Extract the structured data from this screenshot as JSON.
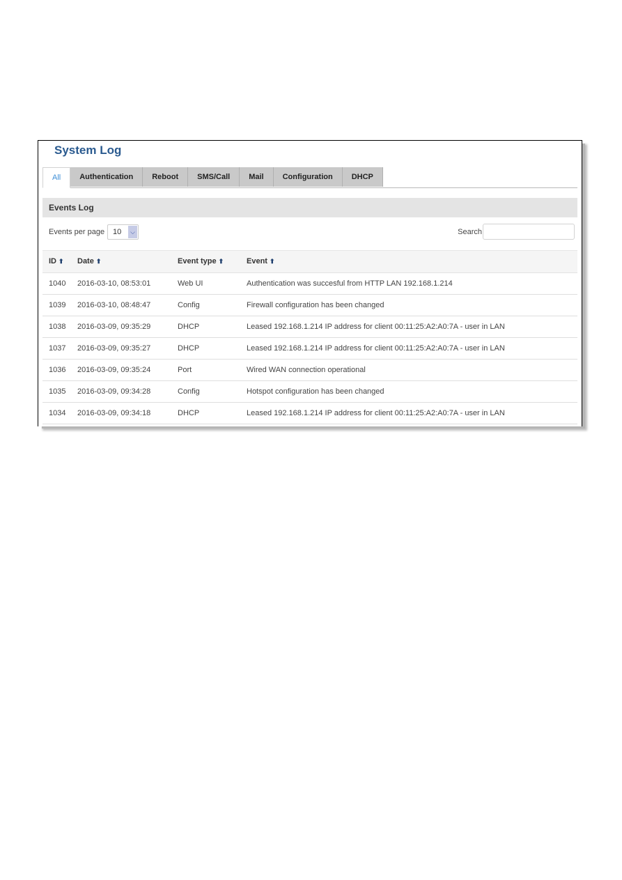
{
  "page": {
    "title": "System Log"
  },
  "tabs": [
    {
      "label": "All",
      "active": true
    },
    {
      "label": "Authentication",
      "active": false
    },
    {
      "label": "Reboot",
      "active": false
    },
    {
      "label": "SMS/Call",
      "active": false
    },
    {
      "label": "Mail",
      "active": false
    },
    {
      "label": "Configuration",
      "active": false
    },
    {
      "label": "DHCP",
      "active": false
    }
  ],
  "events_log": {
    "section_title": "Events Log",
    "per_page_label": "Events per page",
    "per_page_value": "10",
    "per_page_icon": "chevron-down-icon",
    "search_label": "Search",
    "search_value": "",
    "sort_icon": "arrow-up-icon",
    "columns": [
      "ID",
      "Date",
      "Event type",
      "Event"
    ],
    "rows": [
      {
        "id": "1040",
        "date": "2016-03-10, 08:53:01",
        "type": "Web UI",
        "event": "Authentication was succesful from HTTP LAN 192.168.1.214"
      },
      {
        "id": "1039",
        "date": "2016-03-10, 08:48:47",
        "type": "Config",
        "event": "Firewall configuration has been changed"
      },
      {
        "id": "1038",
        "date": "2016-03-09, 09:35:29",
        "type": "DHCP",
        "event": "Leased 192.168.1.214 IP address for client 00:11:25:A2:A0:7A - user in LAN"
      },
      {
        "id": "1037",
        "date": "2016-03-09, 09:35:27",
        "type": "DHCP",
        "event": "Leased 192.168.1.214 IP address for client 00:11:25:A2:A0:7A - user in LAN"
      },
      {
        "id": "1036",
        "date": "2016-03-09, 09:35:24",
        "type": "Port",
        "event": "Wired WAN connection operational"
      },
      {
        "id": "1035",
        "date": "2016-03-09, 09:34:28",
        "type": "Config",
        "event": "Hotspot configuration has been changed"
      },
      {
        "id": "1034",
        "date": "2016-03-09, 09:34:18",
        "type": "DHCP",
        "event": "Leased 192.168.1.214 IP address for client 00:11:25:A2:A0:7A - user in LAN"
      }
    ]
  }
}
